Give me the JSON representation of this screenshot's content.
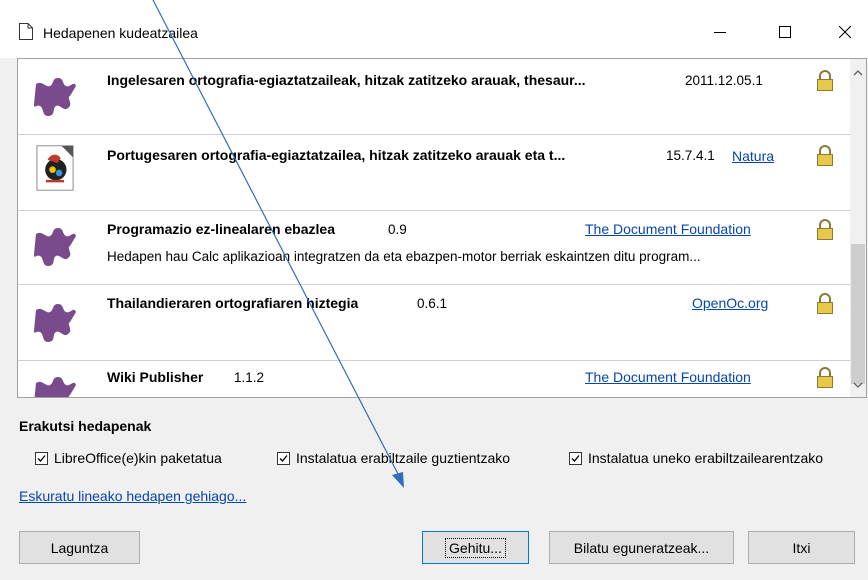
{
  "window": {
    "title": "Hedapenen kudeatzailea",
    "minimize_icon": "minimize-icon",
    "maximize_icon": "maximize-icon",
    "close_icon": "close-icon"
  },
  "extensions": [
    {
      "name": "Ingelesaren ortografia-egiaztatzaileak, hitzak zatitzeko arauak, thesaur...",
      "version": "2011.12.05.1",
      "publisher": "",
      "description": "",
      "icon": "puzzle-icon"
    },
    {
      "name": "Portugesaren ortografia-egiaztatzailea, hitzak zatitzeko arauak eta t...",
      "version": "15.7.4.1",
      "publisher": "Natura",
      "description": "",
      "icon": "rooster-icon"
    },
    {
      "name": "Programazio ez-linealaren ebazlea",
      "version": "0.9",
      "publisher": "The Document Foundation",
      "description": "Hedapen hau Calc aplikazioan integratzen da eta ebazpen-motor berriak eskaintzen ditu program...",
      "icon": "puzzle-icon"
    },
    {
      "name": "Thailandieraren ortografiaren hiztegia",
      "version": "0.6.1",
      "publisher": "OpenOc.org",
      "description": "",
      "icon": "puzzle-icon"
    },
    {
      "name": "Wiki Publisher",
      "version": "1.1.2",
      "publisher": "The Document Foundation",
      "description": "",
      "icon": "puzzle-icon"
    }
  ],
  "filters": {
    "title": "Erakutsi hedapenak",
    "options": [
      {
        "label": "LibreOffice(e)kin paketatua",
        "checked": true
      },
      {
        "label": "Instalatua erabiltzaile guztientzako",
        "checked": true
      },
      {
        "label": "Instalatua uneko erabiltzailearentzako",
        "checked": true
      }
    ]
  },
  "more_link": "Eskuratu lineako hedapen gehiago...",
  "buttons": {
    "help": "Laguntza",
    "add": "Gehitu...",
    "check_updates": "Bilatu eguneratzeak...",
    "close": "Itxi"
  },
  "colors": {
    "puzzle": "#7a4b8c",
    "link": "#0645ad",
    "default_button_border": "#0078d7"
  }
}
